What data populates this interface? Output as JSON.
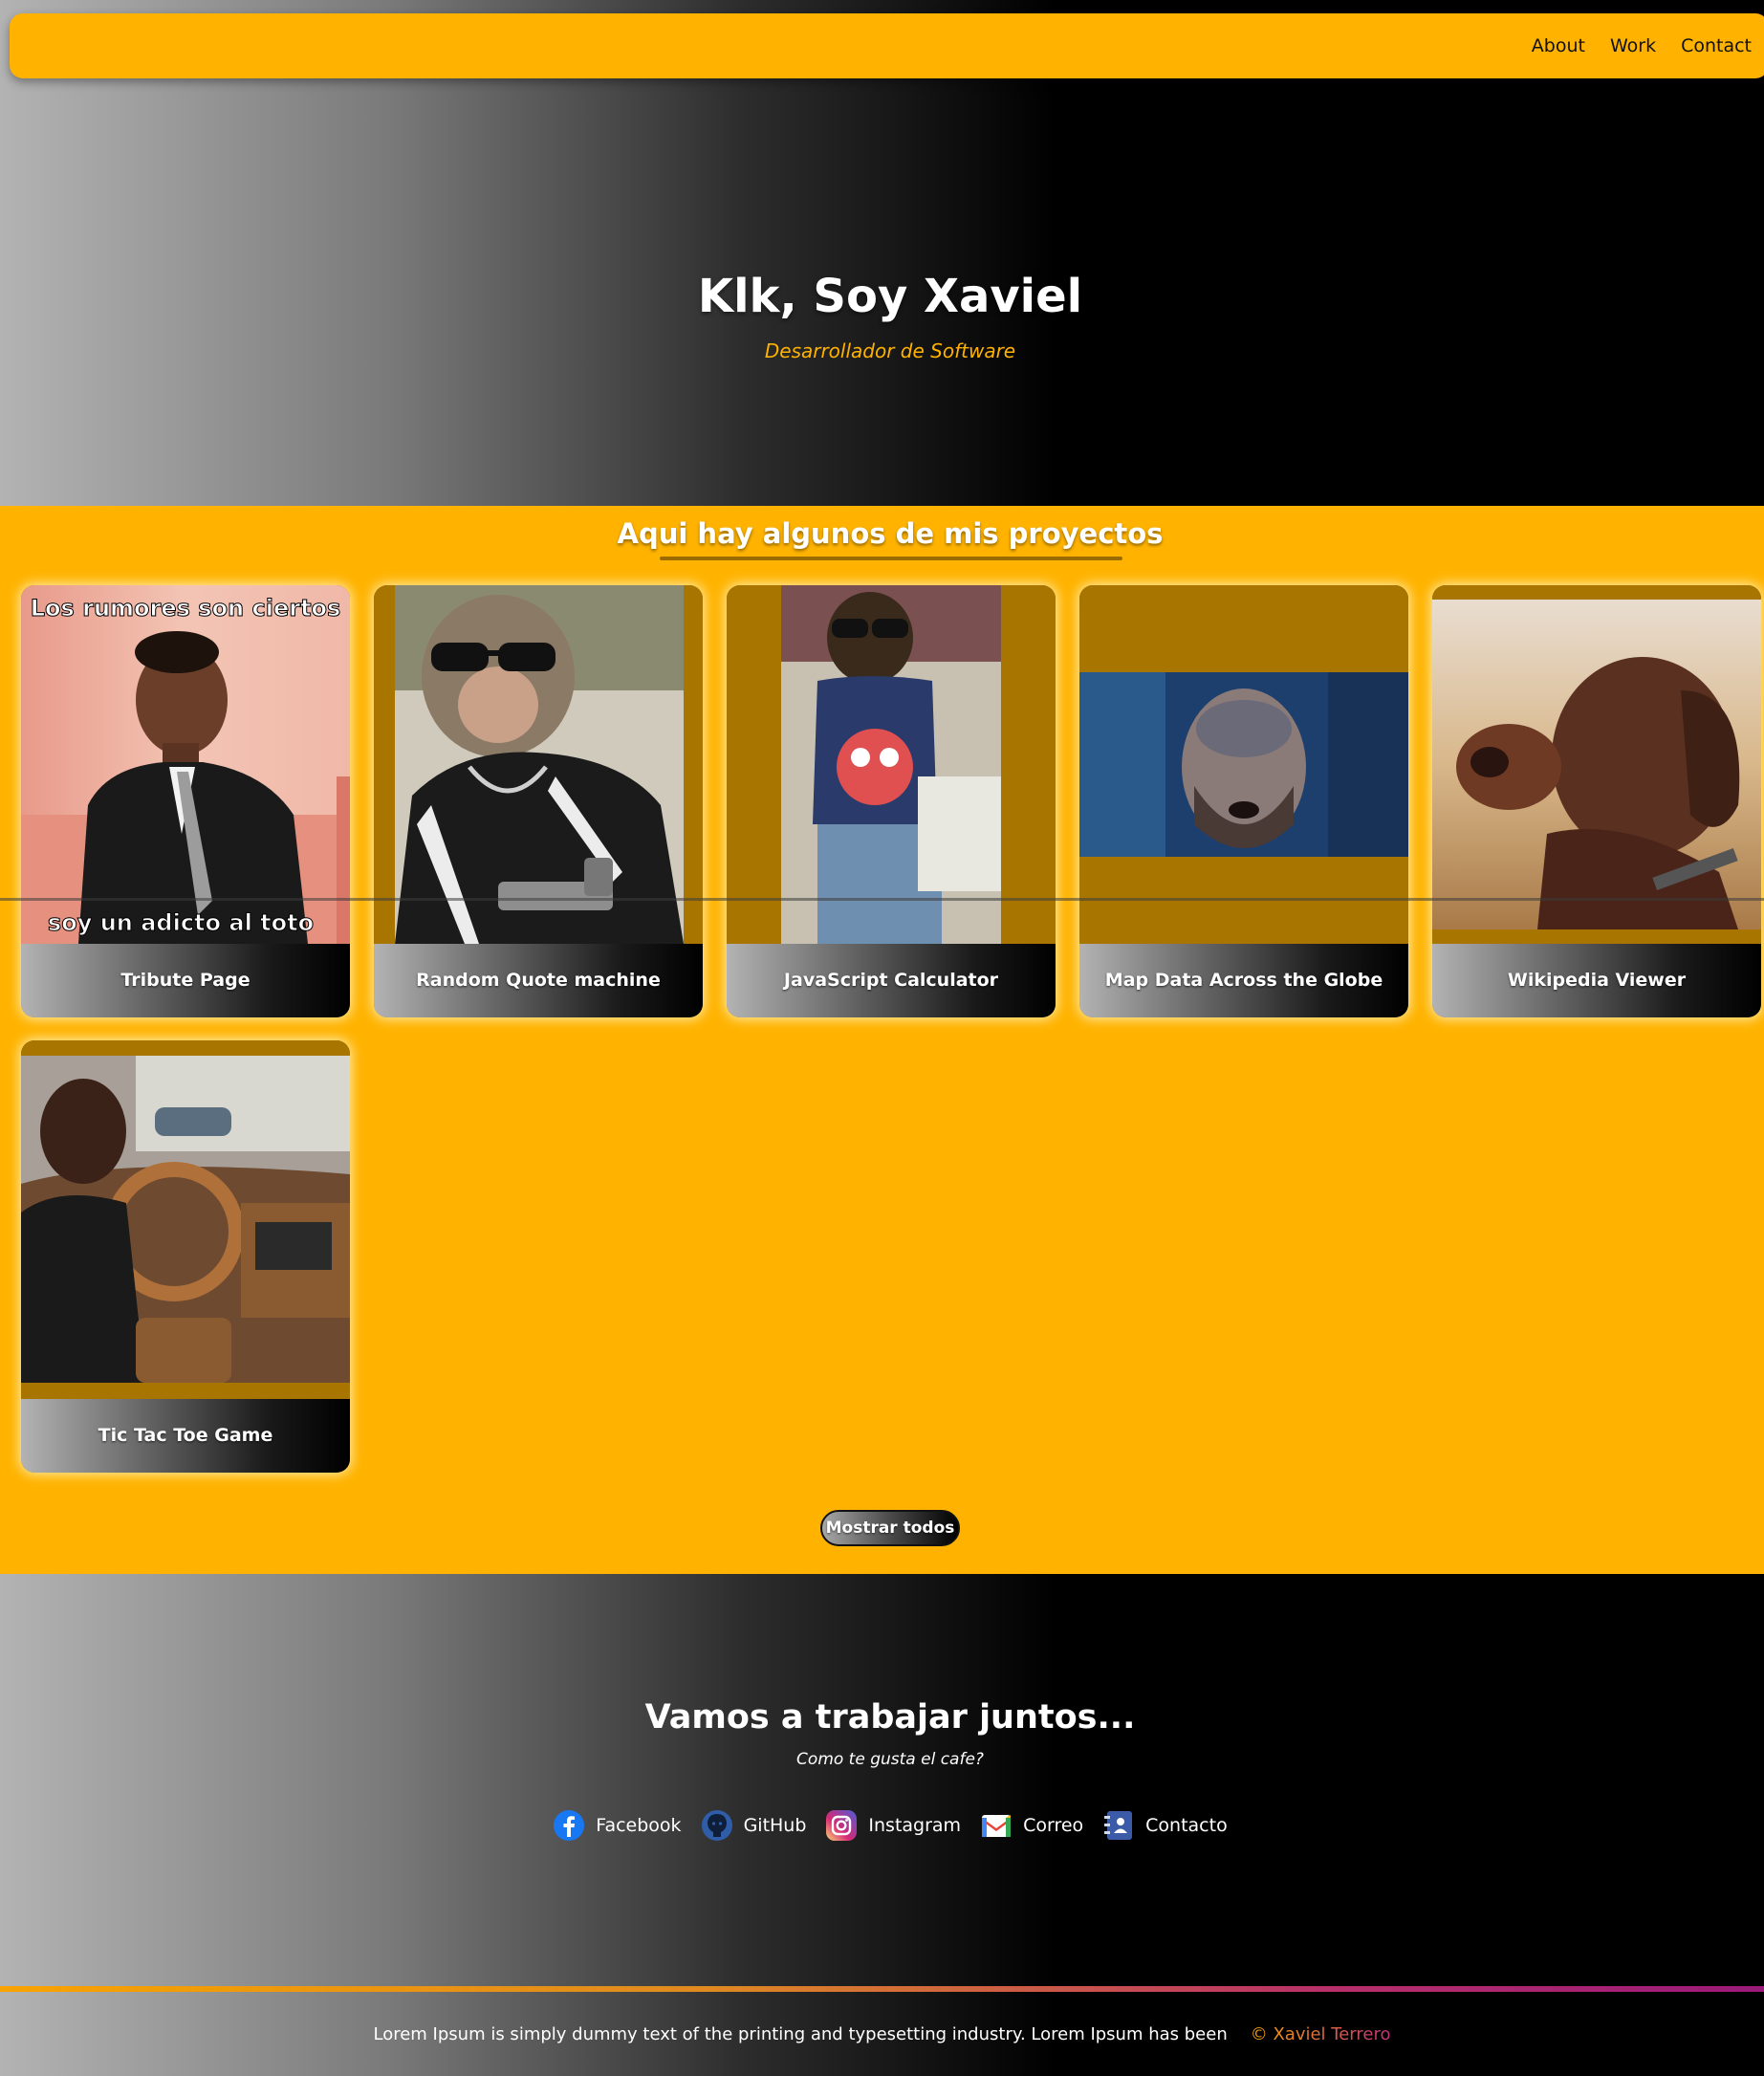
{
  "nav": {
    "links": [
      "About",
      "Work",
      "Contact"
    ]
  },
  "hero": {
    "title": "Klk, Soy Xaviel",
    "subtitle": "Desarrollador de Software"
  },
  "projects": {
    "heading": "Aqui hay algunos de mis proyectos",
    "items": [
      {
        "label": "Tribute Page",
        "image": "photo-boy-in-suit",
        "image_caption_top": "Los rumores son ciertos",
        "image_caption_bottom": "soy un adicto al toto"
      },
      {
        "label": "Random Quote machine",
        "image": "photo-monkey-with-sunglasses"
      },
      {
        "label": "JavaScript Calculator",
        "image": "photo-monkey-lunch-time-shirt"
      },
      {
        "label": "Map Data Across the Globe",
        "image": "photo-man-looking-up"
      },
      {
        "label": "Wikipedia Viewer",
        "image": "photo-brown-dog"
      },
      {
        "label": "Tic Tac Toe Game",
        "image": "photo-boy-in-car"
      }
    ],
    "show_all": "Mostrar todos"
  },
  "contact": {
    "title": "Vamos a trabajar juntos...",
    "subtitle": "Como te gusta el cafe?",
    "links": [
      {
        "label": "Facebook",
        "icon": "facebook-icon"
      },
      {
        "label": "GitHub",
        "icon": "github-icon"
      },
      {
        "label": "Instagram",
        "icon": "instagram-icon"
      },
      {
        "label": "Correo",
        "icon": "gmail-icon"
      },
      {
        "label": "Contacto",
        "icon": "contact-book-icon"
      }
    ]
  },
  "footer": {
    "text": "Lorem Ipsum is simply dummy text of the printing and typesetting industry. Lorem Ipsum has been",
    "copyright": "© Xaviel Terrero"
  },
  "colors": {
    "accent": "#ffb300",
    "accent_dark": "#a87500",
    "footer_gradient_end": "#9a1a7a"
  }
}
